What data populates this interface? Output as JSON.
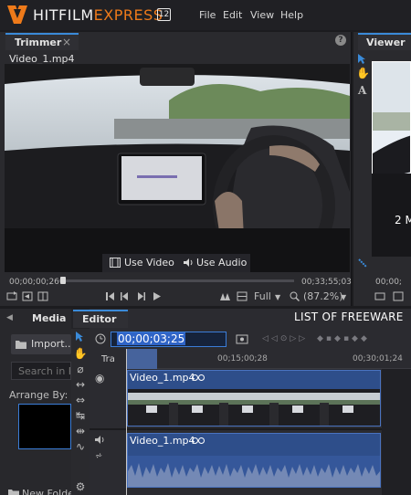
{
  "app": {
    "brand_main": "HITFILM",
    "brand_accent": "EXPRESS",
    "version": "12",
    "accent_color": "#ee7a1a",
    "menu": [
      "File",
      "Edit",
      "View",
      "Help"
    ]
  },
  "trimmer": {
    "tab_label": "Trimmer",
    "close_icon": "×",
    "filename": "Video_1.mp4",
    "use_video": "Use Video",
    "use_audio": "Use Audio",
    "time_start": "00;00;00;26",
    "time_end": "00;33;55;03",
    "quality": "Full",
    "zoom": "(87.2%)"
  },
  "viewer": {
    "tab_label": "Viewer",
    "overlay_text": "2 M",
    "time": "00;00;"
  },
  "media": {
    "tab_label": "Media",
    "import_label": "Import...",
    "search_placeholder": "Search in Pr",
    "arrange_label": "Arrange By: N",
    "new_folder": "New Folde"
  },
  "editor": {
    "tab_label": "Editor",
    "banner": "LIST OF FREEWARE",
    "timecode": "00;00;03;25",
    "track_label": "Tra",
    "ruler_labels": [
      "00;15;00;28",
      "00;30;01;24"
    ],
    "video_clip_name": "Video_1.mp4",
    "audio_clip_name": "Video_1.mp4"
  }
}
